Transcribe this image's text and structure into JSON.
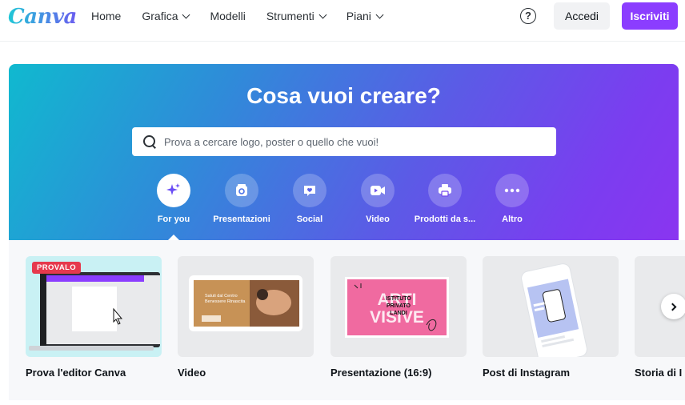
{
  "brand": {
    "logo_text": "Canva"
  },
  "nav": {
    "items": [
      {
        "label": "Home",
        "dropdown": false
      },
      {
        "label": "Grafica",
        "dropdown": true
      },
      {
        "label": "Modelli",
        "dropdown": false
      },
      {
        "label": "Strumenti",
        "dropdown": true
      },
      {
        "label": "Piani",
        "dropdown": true
      }
    ],
    "help_label": "?",
    "login_label": "Accedi",
    "signup_label": "Iscriviti"
  },
  "hero": {
    "title": "Cosa vuoi creare?",
    "search_placeholder": "Prova a cercare logo, poster o quello che vuoi!",
    "categories": [
      {
        "label": "For you",
        "icon": "sparkle-icon",
        "active": true
      },
      {
        "label": "Presentazioni",
        "icon": "presentation-icon",
        "active": false
      },
      {
        "label": "Social",
        "icon": "heart-chat-icon",
        "active": false
      },
      {
        "label": "Video",
        "icon": "video-camera-icon",
        "active": false
      },
      {
        "label": "Prodotti da s...",
        "icon": "printer-icon",
        "active": false
      },
      {
        "label": "Altro",
        "icon": "more-dots-icon",
        "active": false
      }
    ]
  },
  "cards": [
    {
      "label": "Prova l'editor Canva",
      "badge": "PROVALO"
    },
    {
      "label": "Video",
      "thumb_text": "Saluti dal Centro Benessere Rinascita"
    },
    {
      "label": "Presentazione (16:9)",
      "thumb_text_1": "ARTI",
      "thumb_text_2": "VISIVE",
      "thumb_text_3": "ISTITUTO PRIVATO LANDI"
    },
    {
      "label": "Post di Instagram"
    },
    {
      "label": "Storia di I"
    }
  ],
  "colors": {
    "accent": "#8b3dff",
    "badge": "#e6394d",
    "hero_start": "#10b9cf",
    "hero_end": "#8a35f0"
  }
}
